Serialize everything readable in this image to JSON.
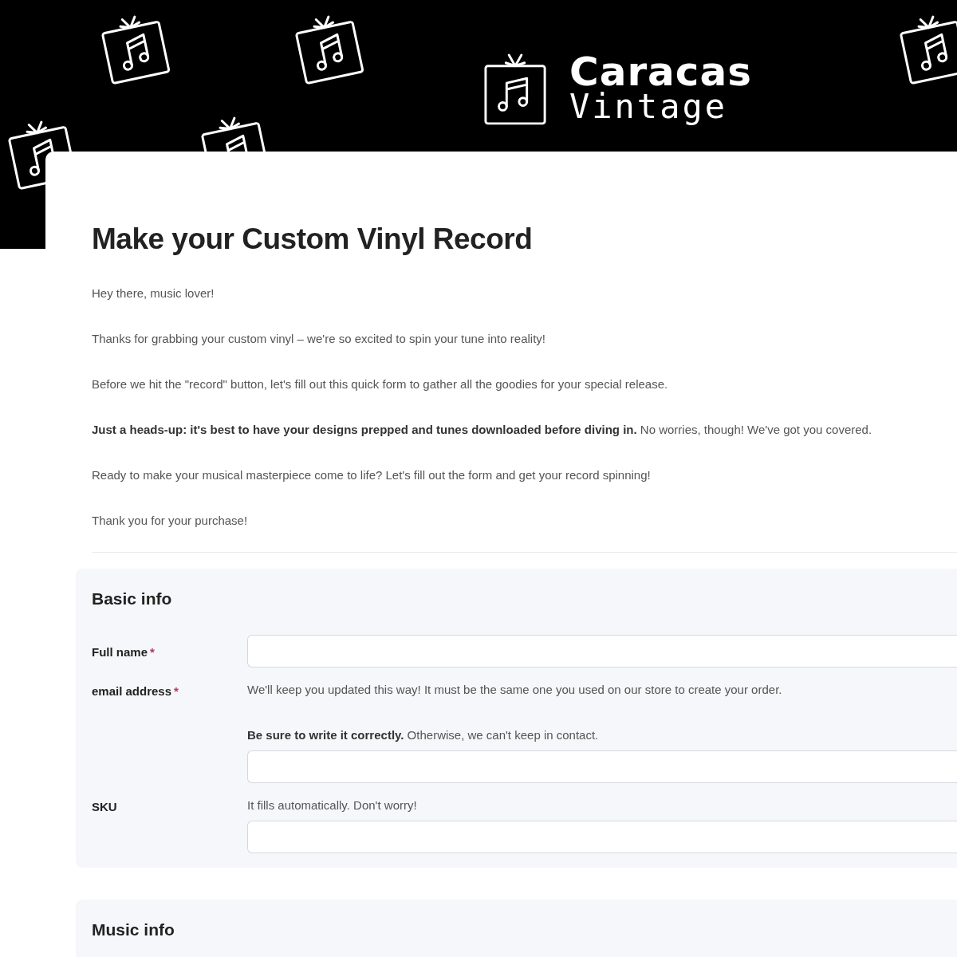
{
  "brand": {
    "name": "Caracas",
    "subtitle": "Vintage"
  },
  "form": {
    "title": "Make your Custom Vinyl Record",
    "intro": [
      "Hey there, music lover!",
      "Thanks for grabbing your custom vinyl – we're so excited to spin your tune into reality!",
      "Before we hit the \"record\" button, let's fill out this quick form to gather all the goodies for your special release.",
      "**Just a heads-up: it's best to have your designs prepped and tunes downloaded before diving in.** No worries, though! We've got you covered.",
      "Ready to make your musical masterpiece come to life? Let's fill out the form and get your record spinning!",
      "Thank you for your purchase!"
    ],
    "sections": [
      {
        "title": "Basic info",
        "fields": [
          {
            "label": "Full name",
            "required_mark": "*"
          },
          {
            "label": "email address",
            "required_mark": "*",
            "help": [
              "We'll keep you updated this way! It must be the same one you used on our store to create your order.",
              "**Be sure to write it correctly.** Otherwise, we can't keep in contact."
            ]
          },
          {
            "label": "SKU",
            "help": [
              "It fills automatically. Don't worry!"
            ]
          }
        ]
      },
      {
        "title": "Music info"
      }
    ]
  }
}
